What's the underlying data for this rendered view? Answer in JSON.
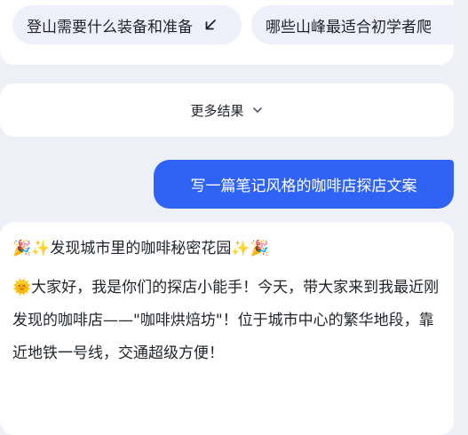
{
  "suggestions": [
    {
      "label": "登山需要什么装备和准备",
      "icon": "arrow-down-left-icon"
    },
    {
      "label": "哪些山峰最适合初学者爬"
    }
  ],
  "more_results": {
    "label": "更多结果",
    "icon": "chevron-down-icon"
  },
  "user_message": {
    "text": "写一篇笔记风格的咖啡店探店文案",
    "bubble_color": "#2f63f5"
  },
  "reply": {
    "title_emoji_left": "🎉✨",
    "title_text": "发现城市里的咖啡秘密花园",
    "title_emoji_right": "✨🎉",
    "body_emoji": "🌞",
    "body_text": "大家好，我是你们的探店小能手！今天，带大家来到我最近刚发现的咖啡店——\"咖啡烘焙坊\"！位于城市中心的繁华地段，靠近地铁一号线，交通超级方便！"
  },
  "colors": {
    "page_background": "#eef0f7",
    "card_background": "#ffffff",
    "chip_background": "#eef0f9",
    "text": "#1f2329"
  }
}
